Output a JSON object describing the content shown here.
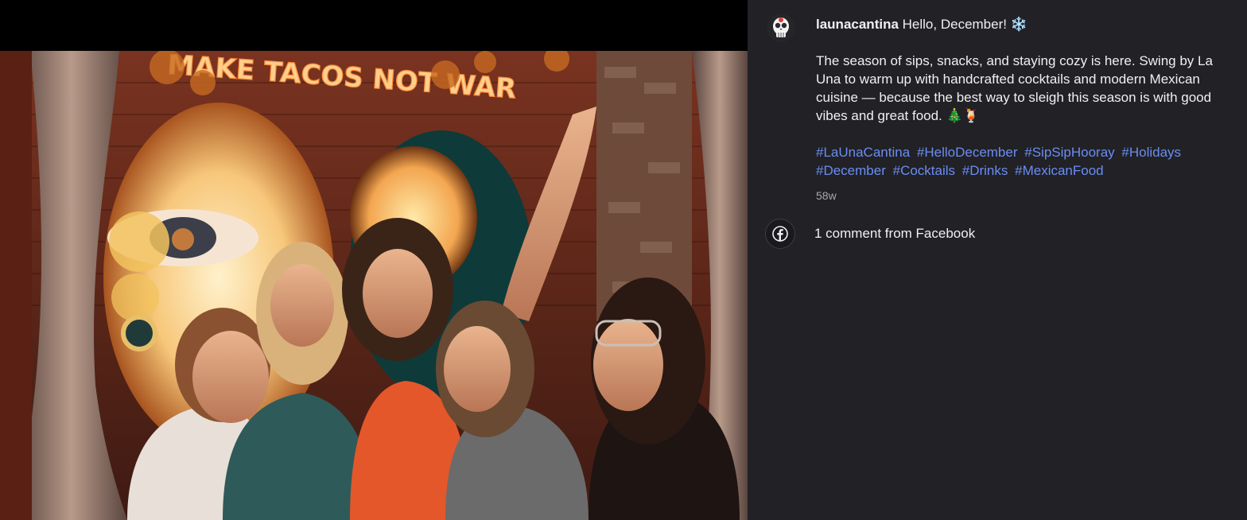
{
  "post": {
    "username": "launacantina",
    "headline": " Hello, December! ❄️",
    "body": "The season of sips, snacks, and staying cozy is here. Swing by La Una to warm up with handcrafted cocktails and modern Mexican cuisine — because the best way to sleigh this season is with good vibes and great food. 🎄🍹",
    "hashtags": [
      "#LaUnaCantina",
      "#HelloDecember",
      "#SipSipHooray",
      "#Holidays",
      "#December",
      "#Cocktails",
      "#Drinks",
      "#MexicanFood"
    ],
    "age": "58w"
  },
  "comments": {
    "label": "1 comment from Facebook",
    "source_icon": "facebook-icon"
  },
  "photo": {
    "neon_sign": "MAKE TACOS NOT WAR"
  },
  "colors": {
    "panel_bg": "#212126",
    "hashtag": "#6b8df2",
    "neon": "#ffb060"
  }
}
